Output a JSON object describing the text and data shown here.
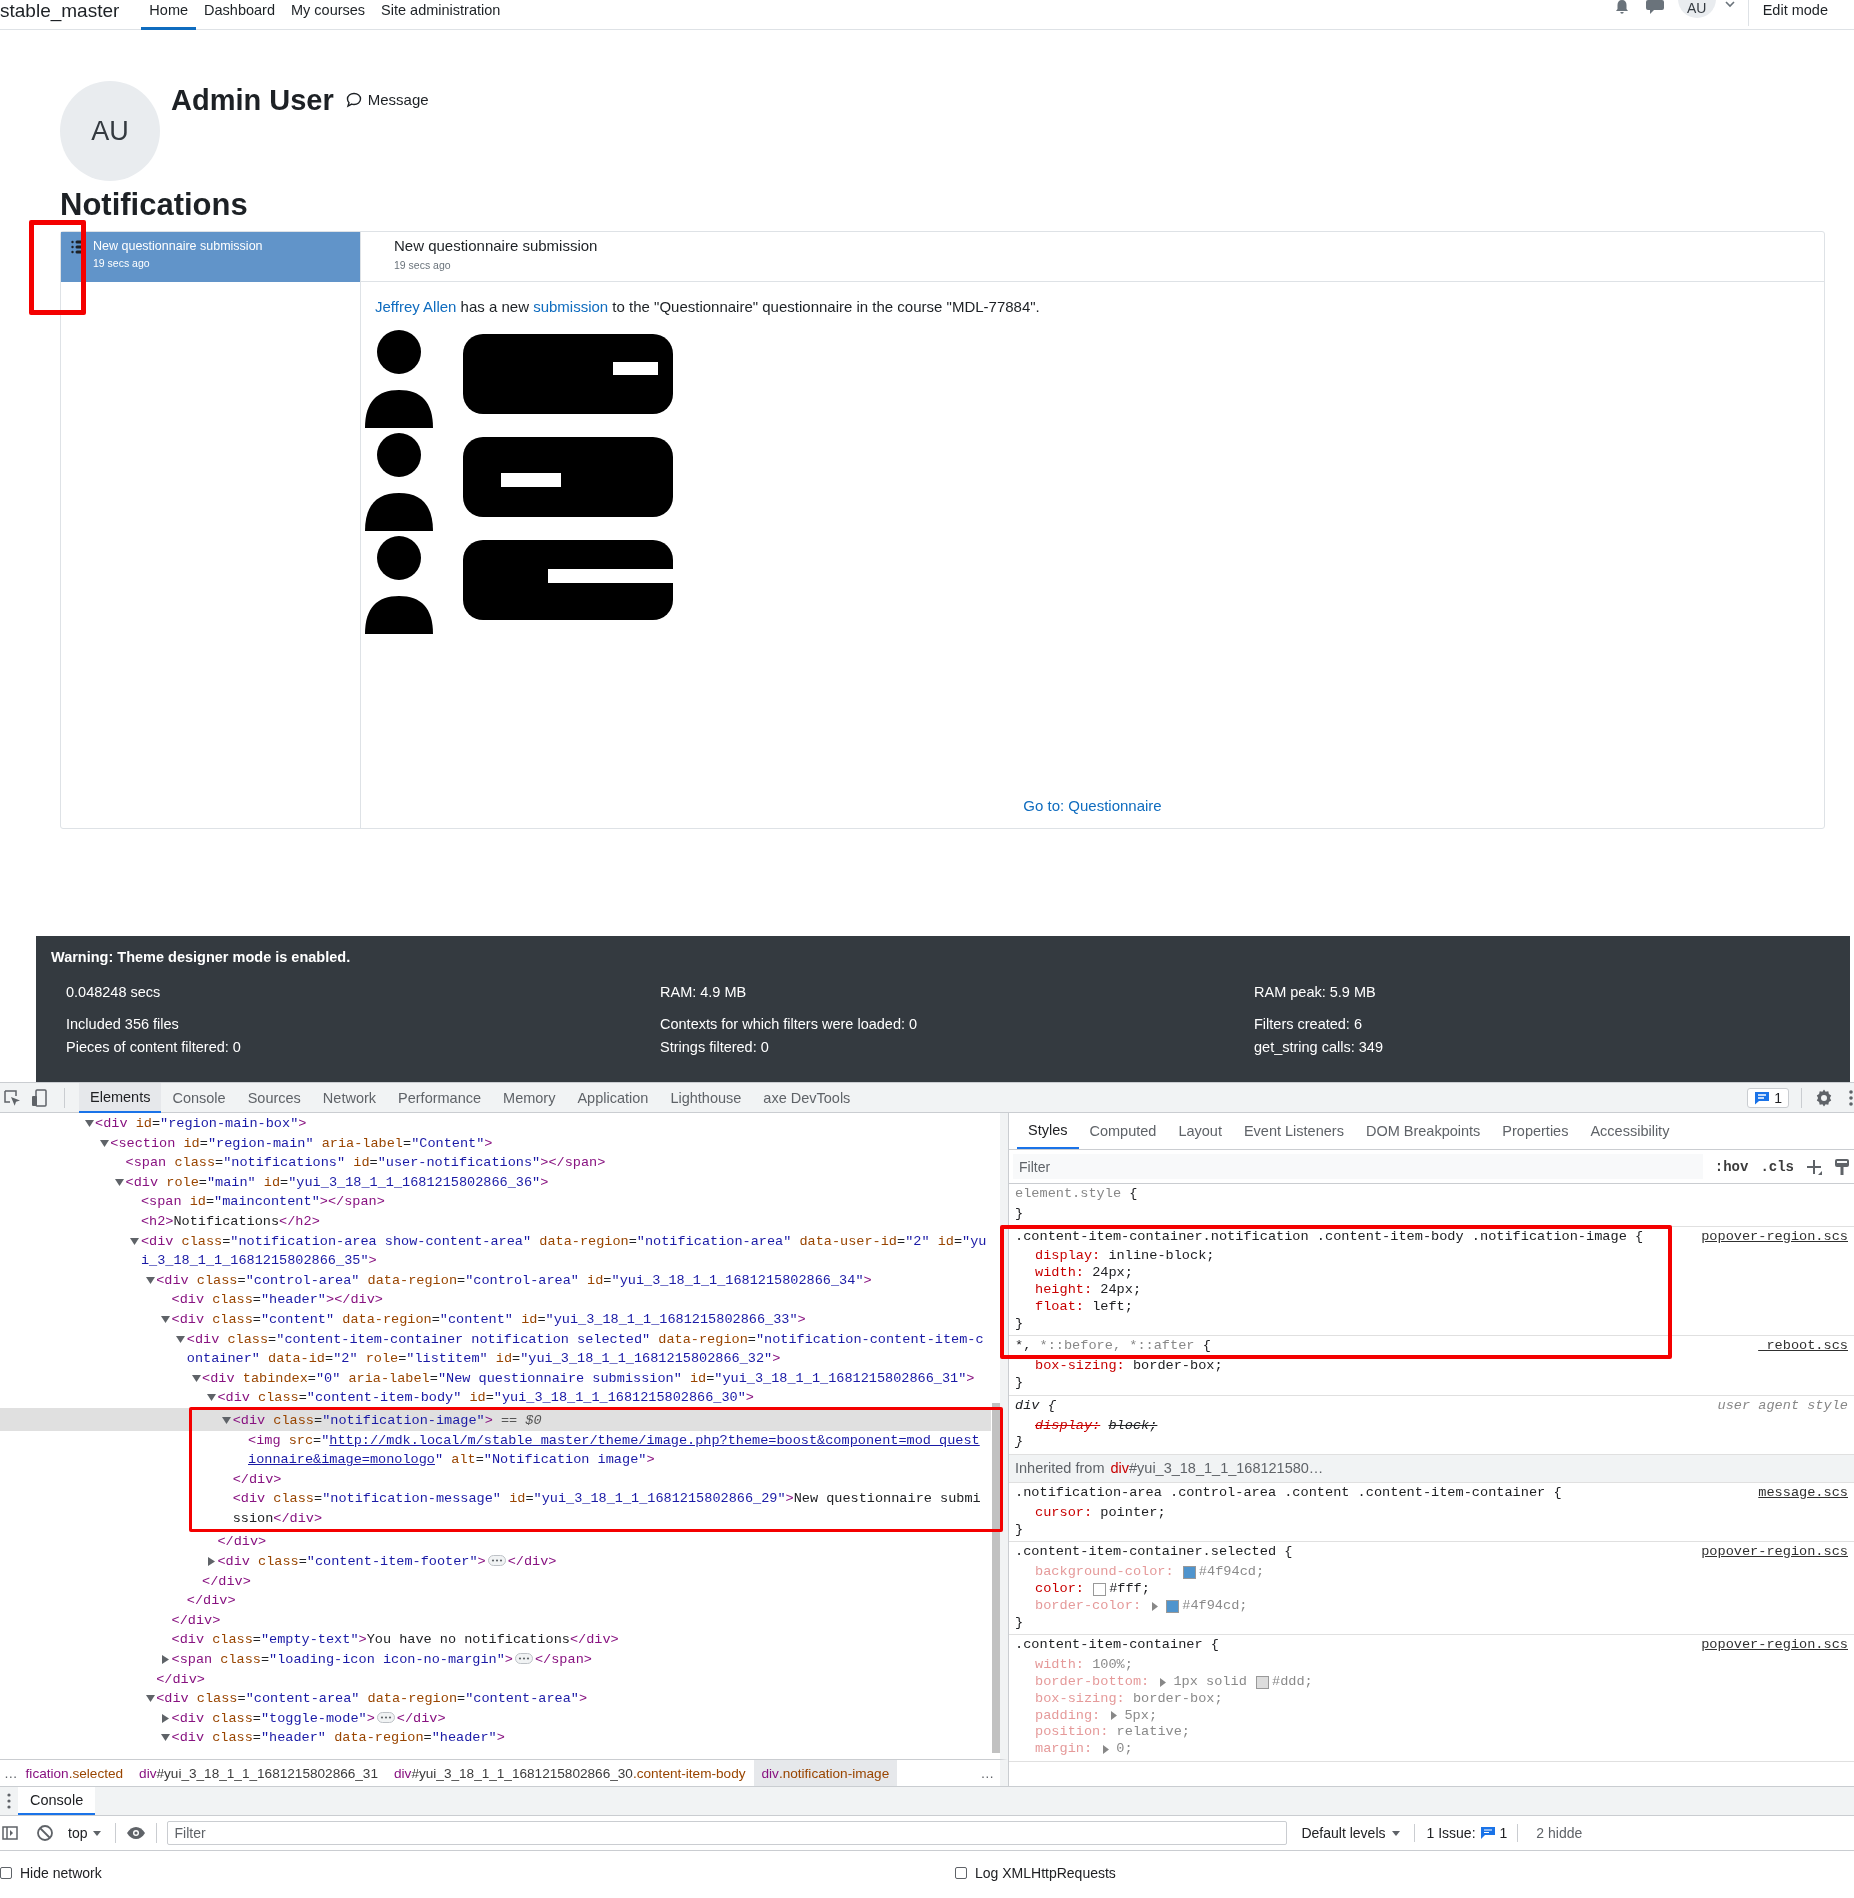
{
  "nav": {
    "brand": "stable_master",
    "items": [
      {
        "label": "Home",
        "selected": true
      },
      {
        "label": "Dashboard",
        "selected": false
      },
      {
        "label": "My courses",
        "selected": false
      },
      {
        "label": "Site administration",
        "selected": false
      }
    ],
    "avatar": "AU",
    "edit_mode": "Edit mode"
  },
  "profile": {
    "initials": "AU",
    "name": "Admin User",
    "message": "Message"
  },
  "heading": "Notifications",
  "notifications": {
    "list": [
      {
        "title": "New questionnaire submission",
        "time": "19 secs ago",
        "selected": true
      }
    ],
    "detail": {
      "title": "New questionnaire submission",
      "time": "19 secs ago",
      "message": [
        {
          "text": "Jeffrey Allen",
          "link": true
        },
        {
          "text": " has a new ",
          "link": false
        },
        {
          "text": "submission",
          "link": true
        },
        {
          "text": " to the \"Questionnaire\" questionnaire in the course \"MDL-77884\".",
          "link": false
        }
      ],
      "link": "Go to: Questionnaire"
    }
  },
  "footer": {
    "warning": "Warning: Theme designer mode is enabled.",
    "columns": [
      [
        "0.048248 secs",
        "Included 356 files",
        "Pieces of content filtered: 0"
      ],
      [
        "RAM: 4.9 MB",
        "Contexts for which filters were loaded: 0",
        "Strings filtered: 0"
      ],
      [
        "RAM peak: 5.9 MB",
        "Filters created: 6",
        "get_string calls: 349"
      ]
    ]
  },
  "devtools": {
    "tabs": [
      {
        "label": "Elements",
        "selected": true
      },
      {
        "label": "Console",
        "selected": false
      },
      {
        "label": "Sources",
        "selected": false
      },
      {
        "label": "Network",
        "selected": false
      },
      {
        "label": "Performance",
        "selected": false
      },
      {
        "label": "Memory",
        "selected": false
      },
      {
        "label": "Application",
        "selected": false
      },
      {
        "label": "Lighthouse",
        "selected": false
      },
      {
        "label": "axe DevTools",
        "selected": false
      }
    ],
    "issues": "1",
    "tree": [
      {
        "text": "<div id=\"region-main-box\">",
        "expanded": true,
        "selected": false,
        "children": [
          {
            "text": "<section id=\"region-main\" aria-label=\"Content\">",
            "expanded": true,
            "selected": false,
            "children": [
              {
                "text": "<span class=\"notifications\" id=\"user-notifications\"></span>",
                "selected": false
              },
              {
                "text": "<div role=\"main\" id=\"yui_3_18_1_1_1681215802866_36\">",
                "expanded": true,
                "selected": false,
                "children": [
                  {
                    "text": "<span id=\"maincontent\"></span>",
                    "selected": false
                  },
                  {
                    "text": "<h2>Notifications</h2>",
                    "selected": false
                  },
                  {
                    "text": "<div class=\"notification-area show-content-area\" data-region=\"notification-area\" data-user-id=\"2\" id=\"yui_3_18_1_1_1681215802866_35\">",
                    "expanded": true,
                    "selected": false,
                    "children": [
                      {
                        "text": "<div class=\"control-area\" data-region=\"control-area\" id=\"yui_3_18_1_1_1681215802866_34\">",
                        "expanded": true,
                        "selected": false,
                        "close": "</div>",
                        "children": [
                          {
                            "text": "<div class=\"header\"></div>",
                            "selected": false
                          },
                          {
                            "text": "<div class=\"content\" data-region=\"content\" id=\"yui_3_18_1_1_1681215802866_33\">",
                            "expanded": true,
                            "selected": false,
                            "close": "</div>",
                            "children": [
                              {
                                "text": "<div class=\"content-item-container notification selected\" data-region=\"notification-content-item-container\" data-id=\"2\" role=\"listitem\" id=\"yui_3_18_1_1_1681215802866_32\">",
                                "expanded": true,
                                "selected": false,
                                "close": "</div>",
                                "children": [
                                  {
                                    "text": "<div tabindex=\"0\" aria-label=\"New questionnaire submission\" id=\"yui_3_18_1_1_1681215802866_31\">",
                                    "expanded": true,
                                    "selected": false,
                                    "close": "</div>",
                                    "children": [
                                      {
                                        "text": "<div class=\"content-item-body\" id=\"yui_3_18_1_1_1681215802866_30\">",
                                        "expanded": true,
                                        "selected": false,
                                        "close": "</div>",
                                        "children": [
                                          {
                                            "text": "<div class=\"notification-image\">",
                                            "expanded": true,
                                            "selected": true,
                                            "ref": "== $0",
                                            "close": "</div>",
                                            "children": [
                                              {
                                                "text": "<img src=\"http://mdk.local/m/stable_master/theme/image.php?theme=boost&component=mod_questionnaire&image=monologo\" alt=\"Notification image\">",
                                                "selected": false
                                              }
                                            ]
                                          },
                                          {
                                            "text": "<div class=\"notification-message\" id=\"yui_3_18_1_1_1681215802866_29\">New questionnaire submission</div>",
                                            "selected": false
                                          }
                                        ]
                                      },
                                      {
                                        "text": "<div class=\"content-item-footer\">",
                                        "expanded": false,
                                        "selected": false,
                                        "tail": "</div>"
                                      }
                                    ]
                                  }
                                ]
                              }
                            ]
                          },
                          {
                            "text": "<div class=\"empty-text\">You have no notifications</div>",
                            "selected": false
                          },
                          {
                            "text": "<span class=\"loading-icon icon-no-margin\">",
                            "expanded": false,
                            "selected": false,
                            "tail": "</span>"
                          }
                        ]
                      },
                      {
                        "text": "<div class=\"content-area\" data-region=\"content-area\">",
                        "expanded": true,
                        "selected": false,
                        "children": [
                          {
                            "text": "<div class=\"toggle-mode\">",
                            "expanded": false,
                            "selected": false,
                            "tail": "</div>"
                          },
                          {
                            "text": "<div class=\"header\" data-region=\"header\">",
                            "expanded": true,
                            "selected": false
                          }
                        ]
                      }
                    ]
                  }
                ]
              }
            ]
          }
        ]
      }
    ],
    "breadcrumbs": {
      "lead": "…",
      "trail": "…",
      "items": [
        {
          "text": "fication.selected",
          "selected": false
        },
        {
          "text": "div#yui_3_18_1_1_1681215802866_31",
          "selected": false
        },
        {
          "text": "div#yui_3_18_1_1_1681215802866_30.content-item-body",
          "selected": false
        },
        {
          "text": "div.notification-image",
          "selected": true
        }
      ]
    },
    "styles": {
      "tabs": [
        {
          "label": "Styles",
          "selected": true
        },
        {
          "label": "Computed",
          "selected": false
        },
        {
          "label": "Layout",
          "selected": false
        },
        {
          "label": "Event Listeners",
          "selected": false
        },
        {
          "label": "DOM Breakpoints",
          "selected": false
        },
        {
          "label": "Properties",
          "selected": false
        },
        {
          "label": "Accessibility",
          "selected": false
        }
      ],
      "filter_placeholder": "Filter",
      "hov": ":hov",
      "cls": ".cls",
      "rules": [
        {
          "kind": "rule",
          "selector": [
            {
              "text": "element.style",
              "matched": false
            },
            {
              "text": " {",
              "matched": true
            }
          ],
          "close": "}"
        },
        {
          "kind": "rule",
          "selector": [
            {
              "text": ".content-item-container.notification .content-item-body .notification-image {",
              "matched": true
            }
          ],
          "source": "popover-region.scs",
          "close": "}",
          "properties": [
            {
              "name": "display:",
              "value": [
                {
                  "text": "inline-block;"
                }
              ]
            },
            {
              "name": "width:",
              "value": [
                {
                  "text": "24px;"
                }
              ]
            },
            {
              "name": "height:",
              "value": [
                {
                  "text": "24px;"
                }
              ]
            },
            {
              "name": "float:",
              "value": [
                {
                  "text": "left;"
                }
              ]
            }
          ]
        },
        {
          "kind": "rule",
          "selector": [
            {
              "text": "*,",
              "matched": true
            },
            {
              "text": " *::before, *::after",
              "matched": false
            },
            {
              "text": " {",
              "matched": true
            }
          ],
          "source": "_reboot.scs",
          "close": "}",
          "properties": [
            {
              "name": "box-sizing:",
              "value": [
                {
                  "text": "border-box;"
                }
              ]
            }
          ]
        },
        {
          "kind": "rule",
          "user_agent": true,
          "selector": [
            {
              "text": "div {",
              "matched": true
            }
          ],
          "source": "user agent style",
          "close": "}",
          "properties": [
            {
              "name": "display:",
              "value": [
                {
                  "text": "block;"
                }
              ],
              "overridden": true
            }
          ]
        },
        {
          "kind": "inherited",
          "label": "Inherited from",
          "element": "div#yui_3_18_1_1_168121580…"
        },
        {
          "kind": "rule",
          "selector": [
            {
              "text": ".notification-area .control-area .content .content-item-container {",
              "matched": true
            }
          ],
          "source": "message.scs",
          "close": "}",
          "properties": [
            {
              "name": "cursor:",
              "value": [
                {
                  "text": "pointer;"
                }
              ]
            }
          ]
        },
        {
          "kind": "rule",
          "selector": [
            {
              "text": ".content-item-container.selected {",
              "matched": true
            }
          ],
          "source": "popover-region.scs",
          "close": "}",
          "properties": [
            {
              "name": "background-color:",
              "value": [
                {
                  "text": "#4f94cd;",
                  "color": "#4f94cd"
                }
              ],
              "inactive": true
            },
            {
              "name": "color:",
              "value": [
                {
                  "text": "#fff;",
                  "color": "#ffffff"
                }
              ],
              "inactive": false
            },
            {
              "name": "border-color:",
              "expandable": true,
              "value": [
                {
                  "text": "#4f94cd;",
                  "color": "#4f94cd"
                }
              ],
              "inactive": true
            }
          ]
        },
        {
          "kind": "rule",
          "selector": [
            {
              "text": ".content-item-container {",
              "matched": true
            }
          ],
          "source": "popover-region.scs",
          "properties": [
            {
              "name": "width:",
              "value": [
                {
                  "text": "100%;"
                }
              ],
              "inactive": true
            },
            {
              "name": "border-bottom:",
              "expandable": true,
              "value": [
                {
                  "text": "1px solid "
                },
                {
                  "text": "#ddd;",
                  "color": "#dddddd"
                }
              ],
              "inactive": true
            },
            {
              "name": "box-sizing:",
              "value": [
                {
                  "text": "border-box;"
                }
              ],
              "inactive": true
            },
            {
              "name": "padding:",
              "expandable": true,
              "value": [
                {
                  "text": "5px;"
                }
              ],
              "inactive": true
            },
            {
              "name": "position:",
              "value": [
                {
                  "text": "relative;"
                }
              ],
              "inactive": true
            },
            {
              "name": "margin:",
              "expandable": true,
              "value": [
                {
                  "text": "0;"
                }
              ],
              "inactive": true
            }
          ]
        }
      ]
    }
  },
  "console": {
    "tab": "Console",
    "context": "top",
    "filter_placeholder": "Filter",
    "levels": "Default levels",
    "issues_label": "1 Issue:",
    "issues_count": "1",
    "hidden": "2 hidde",
    "checkboxes": [
      {
        "label": "Hide network",
        "checked": false
      },
      {
        "label": "Log XMLHttpRequests",
        "checked": false
      }
    ]
  }
}
